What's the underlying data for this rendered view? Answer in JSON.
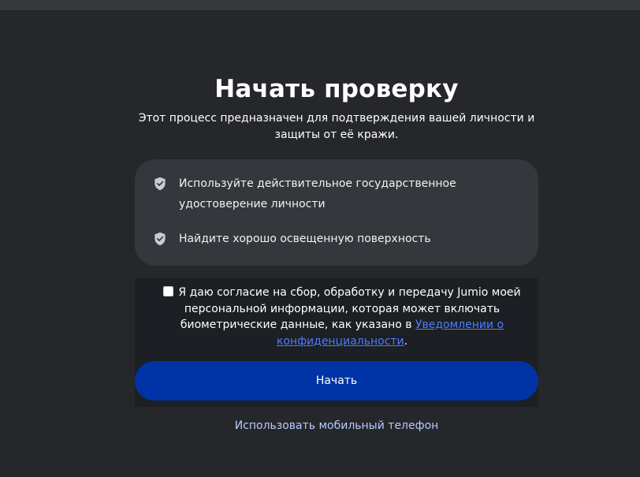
{
  "header": {
    "title": "Начать проверку",
    "subtitle": "Этот процесс предназначен для подтверждения вашей личности и защиты от её кражи."
  },
  "tips": [
    {
      "icon": "shield-check-icon",
      "text": "Используйте действительное государственное удостоверение личности"
    },
    {
      "icon": "shield-check-icon",
      "text": "Найдите хорошо освещенную поверхность"
    }
  ],
  "consent": {
    "checked": false,
    "text_before": "Я даю согласие на сбор, обработку и передачу Jumio моей персональной информации, которая может включать биометрические данные, как указано в ",
    "link_text": "Уведомлении о конфиденциальности",
    "text_after": "."
  },
  "actions": {
    "start_label": "Начать",
    "mobile_label": "Использовать мобильный телефон"
  },
  "colors": {
    "background": "#25272a",
    "card": "#34373b",
    "consent_panel": "#1c1f23",
    "primary_button": "#0034a6",
    "link": "#4d7cff",
    "secondary_link": "#b9c9ff"
  }
}
